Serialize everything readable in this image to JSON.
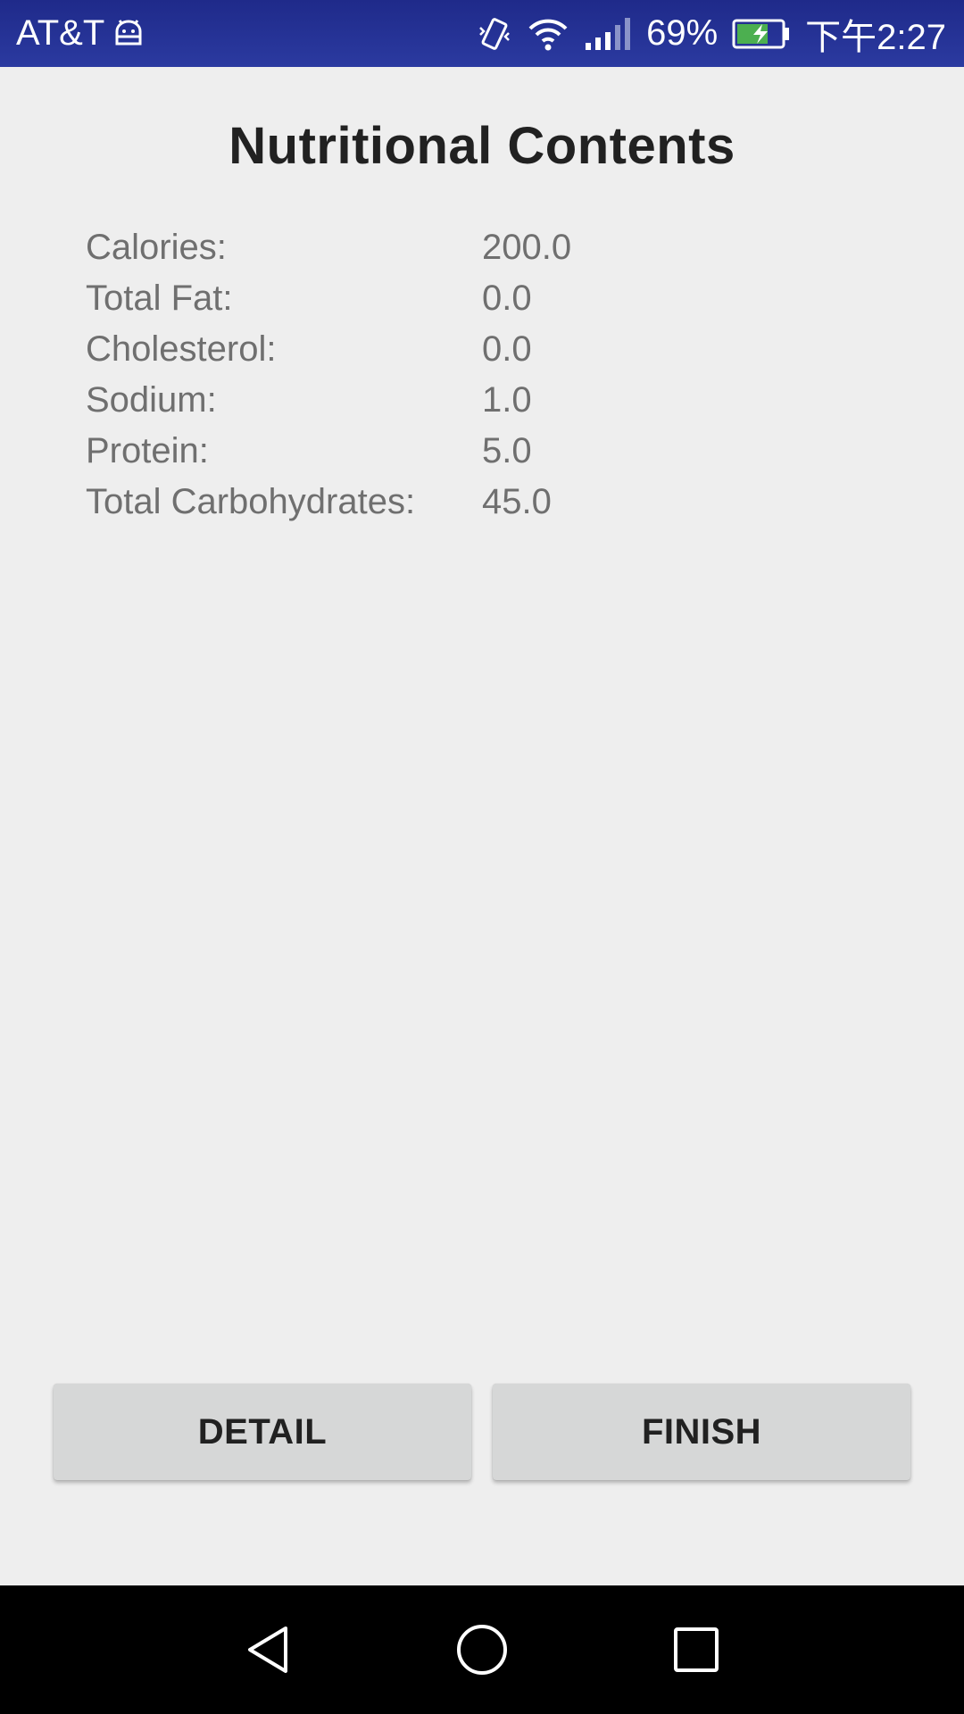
{
  "status_bar": {
    "carrier": "AT&T",
    "battery_percent": "69%",
    "time": "下午2:27",
    "icons": [
      "android-debug-icon",
      "vibrate-icon",
      "wifi-icon",
      "signal-icon",
      "battery-charging-icon"
    ]
  },
  "page": {
    "title": "Nutritional Contents"
  },
  "nutrients": [
    {
      "label": "Calories:",
      "value": "200.0"
    },
    {
      "label": "Total Fat:",
      "value": "0.0"
    },
    {
      "label": "Cholesterol:",
      "value": "0.0"
    },
    {
      "label": "Sodium:",
      "value": "1.0"
    },
    {
      "label": "Protein:",
      "value": "5.0"
    },
    {
      "label": "Total Carbohydrates:",
      "value": "45.0"
    }
  ],
  "buttons": {
    "detail_label": "DETAIL",
    "finish_label": "FINISH"
  },
  "nav_bar": {
    "icons": [
      "back-icon",
      "home-icon",
      "recents-icon"
    ]
  },
  "colors": {
    "status_bar": "#2b3aa0",
    "background": "#eeeeee",
    "button": "#d6d7d7",
    "battery_fill": "#4caf50"
  }
}
